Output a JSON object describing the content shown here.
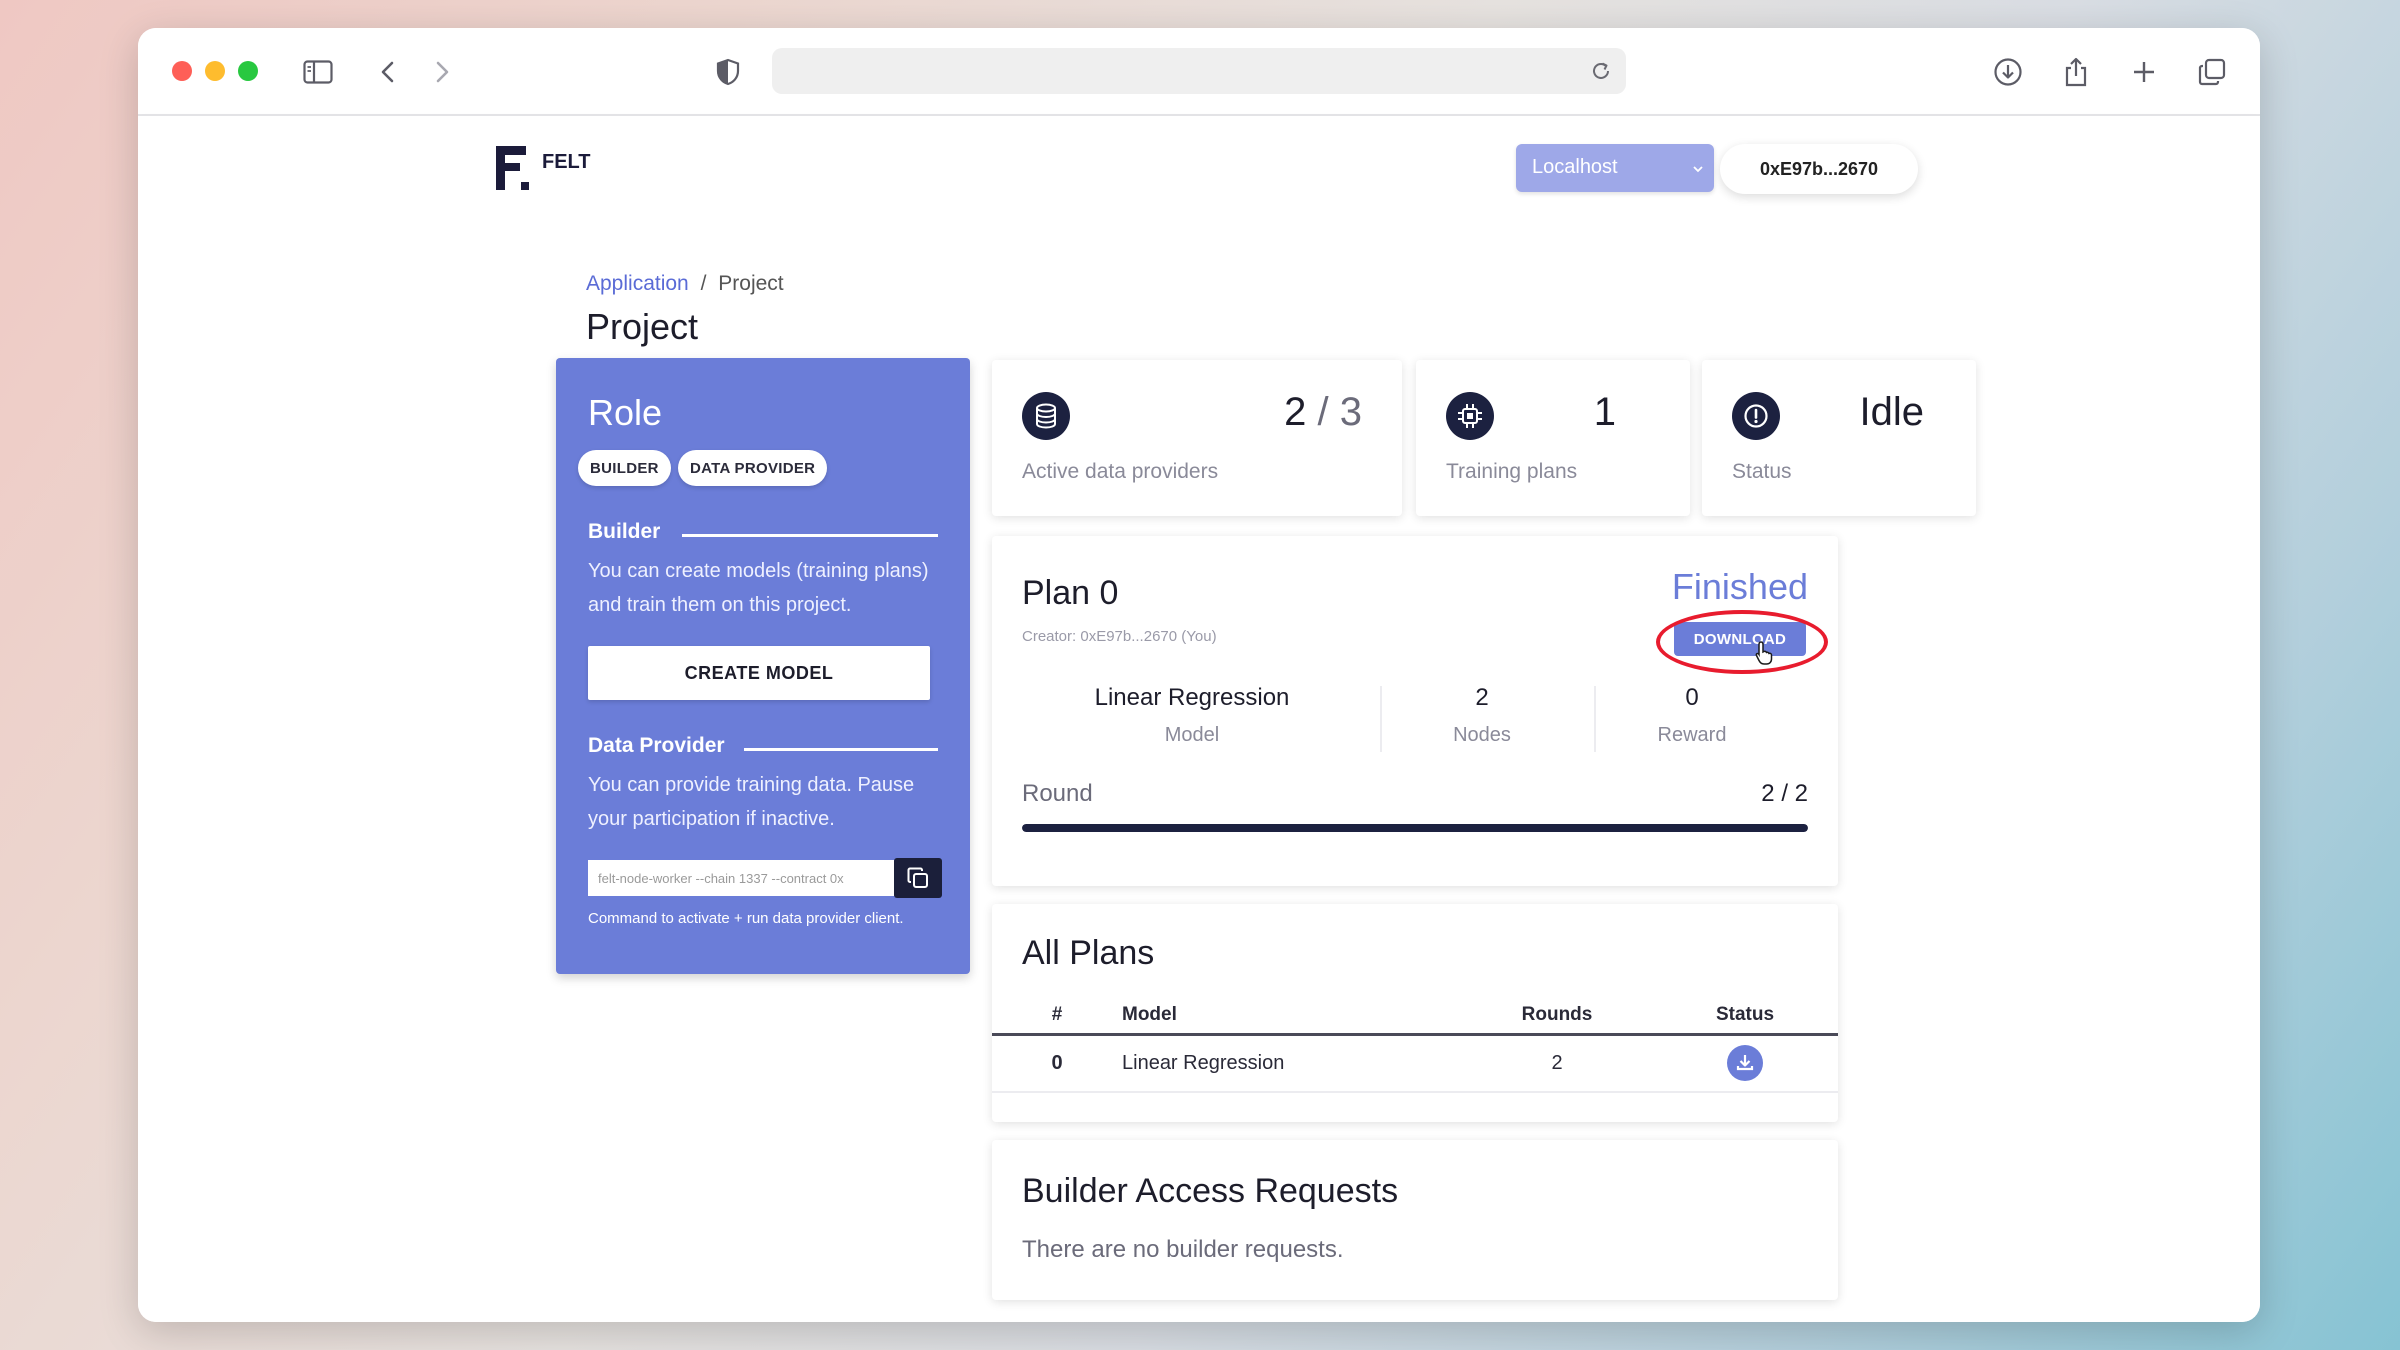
{
  "browser": {
    "url": "",
    "traffic_lights": {
      "close": "#fe5f57",
      "minimize": "#febc2e",
      "zoom": "#28c840"
    }
  },
  "app": {
    "logo_letter": "F",
    "name": "FELT",
    "network_select": {
      "selected": "Localhost"
    },
    "address": "0xE97b...2670"
  },
  "breadcrumb": {
    "parent": "Application",
    "separator": "/",
    "current": "Project"
  },
  "page_title": "Project",
  "role": {
    "title": "Role",
    "chips": [
      "BUILDER",
      "DATA PROVIDER"
    ],
    "builder": {
      "heading": "Builder",
      "text": "You can create models (training plans) and train them on this project.",
      "button": "CREATE MODEL"
    },
    "data_provider": {
      "heading": "Data Provider",
      "text": "You can provide training data. Pause your participation if inactive.",
      "command_value": "felt-node-worker --chain 1337 --contract 0x",
      "hint": "Command to activate + run data provider client."
    }
  },
  "stats": [
    {
      "icon": "database-icon",
      "value": "2",
      "total": "/ 3",
      "label": "Active data providers"
    },
    {
      "icon": "cpu-chip-icon",
      "value": "1",
      "label": "Training plans"
    },
    {
      "icon": "alert-circle-icon",
      "value": "Idle",
      "label": "Status"
    }
  ],
  "plan": {
    "title": "Plan 0",
    "creator": "Creator: 0xE97b...2670 (You)",
    "status": "Finished",
    "download_label": "DOWNLOAD",
    "metrics": [
      {
        "value": "Linear Regression",
        "label": "Model"
      },
      {
        "value": "2",
        "label": "Nodes"
      },
      {
        "value": "0",
        "label": "Reward"
      }
    ],
    "round_label": "Round",
    "round_value": "2 / 2",
    "progress_fraction": 1.0
  },
  "all_plans": {
    "title": "All Plans",
    "columns": [
      "#",
      "Model",
      "Rounds",
      "Status"
    ],
    "rows": [
      {
        "index": "0",
        "model": "Linear Regression",
        "rounds": "2",
        "status_icon": "download-icon"
      }
    ]
  },
  "builder_requests": {
    "title": "Builder Access Requests",
    "empty_text": "There are no builder requests."
  },
  "colors": {
    "accent": "#6b7dd8",
    "dark": "#1c2140",
    "highlight_ring": "#e81c2e"
  }
}
